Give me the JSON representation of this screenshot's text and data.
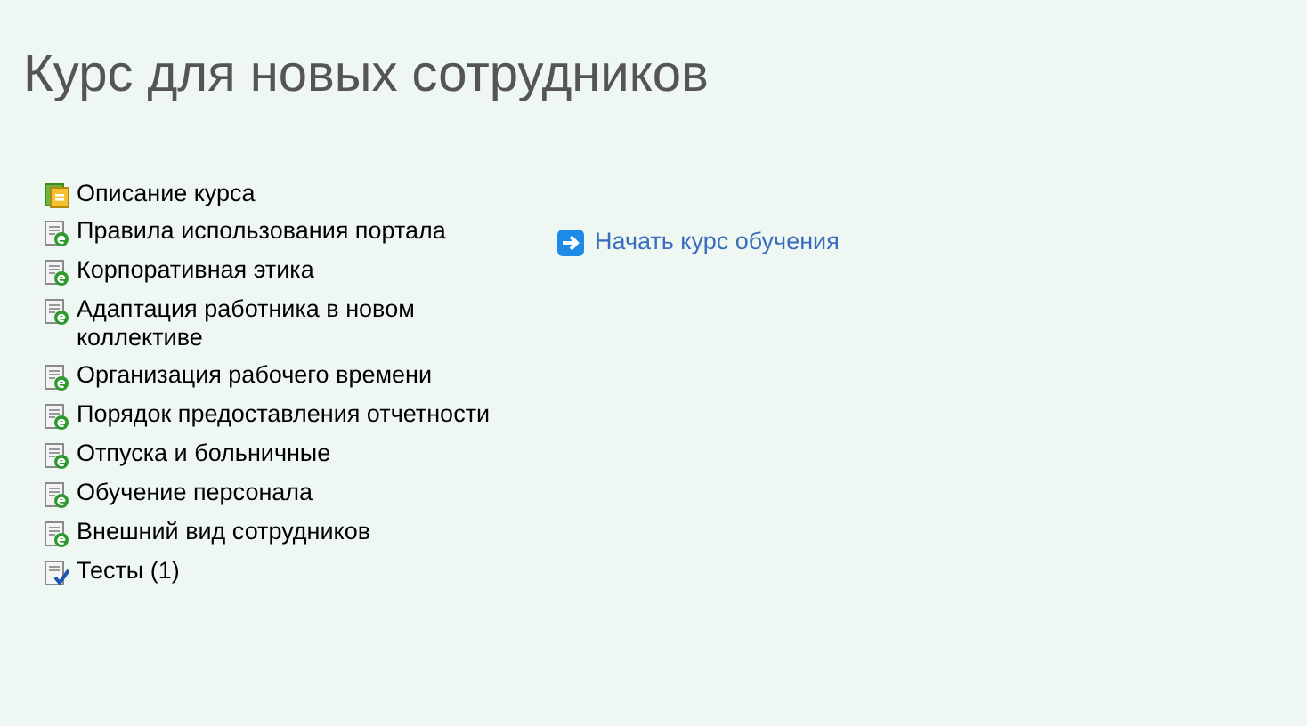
{
  "title": "Курс для новых сотрудников",
  "items": [
    {
      "kind": "description",
      "label": "Описание курса"
    },
    {
      "kind": "lesson",
      "label": "Правила использования портала"
    },
    {
      "kind": "lesson",
      "label": "Корпоративная этика"
    },
    {
      "kind": "lesson",
      "label": "Адаптация работника в новом коллективе"
    },
    {
      "kind": "lesson",
      "label": "Организация рабочего времени"
    },
    {
      "kind": "lesson",
      "label": "Порядок предоставления отчетности"
    },
    {
      "kind": "lesson",
      "label": "Отпуска и больничные"
    },
    {
      "kind": "lesson",
      "label": "Обучение персонала"
    },
    {
      "kind": "lesson",
      "label": "Внешний вид сотрудников"
    },
    {
      "kind": "test",
      "label": "Тесты (1)"
    }
  ],
  "start_link": "Начать курс обучения"
}
